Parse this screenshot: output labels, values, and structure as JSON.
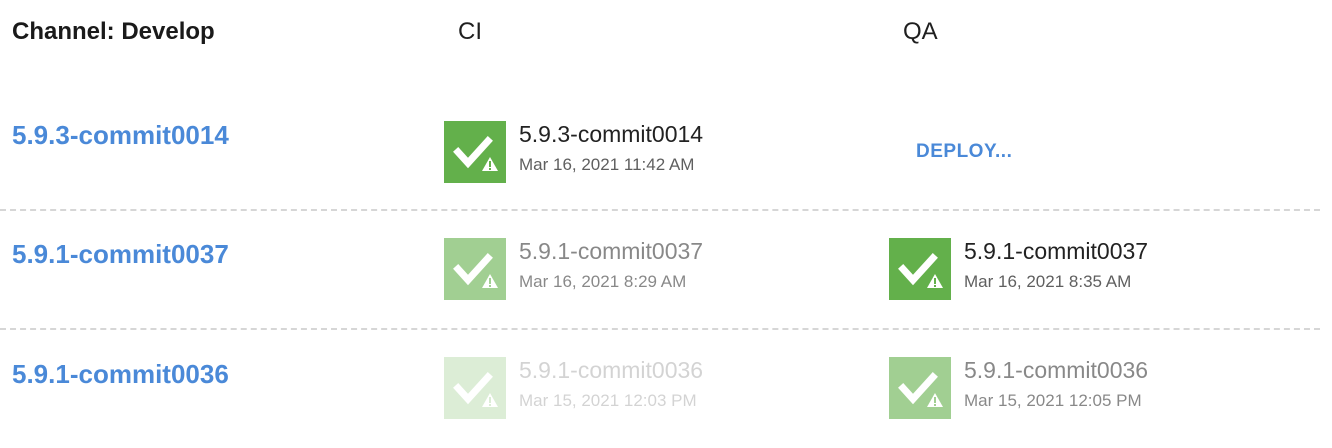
{
  "header": {
    "channel_title": "Channel: Develop",
    "environments": [
      "CI",
      "QA"
    ]
  },
  "colors": {
    "link": "#4a89d8",
    "success_tile": "#63b04b",
    "divider": "#d6d6d6"
  },
  "icons": {
    "status_tile": "success-with-warning-icon"
  },
  "releases": [
    {
      "version": "5.9.3-commit0014",
      "ci": {
        "version": "5.9.3-commit0014",
        "date": "Mar 16, 2021 11:42 AM",
        "status": "success-with-warning"
      },
      "qa": {
        "action_label": "DEPLOY..."
      }
    },
    {
      "version": "5.9.1-commit0037",
      "ci": {
        "version": "5.9.1-commit0037",
        "date": "Mar 16, 2021 8:29 AM",
        "status": "success-with-warning"
      },
      "qa": {
        "version": "5.9.1-commit0037",
        "date": "Mar 16, 2021 8:35 AM",
        "status": "success-with-warning"
      }
    },
    {
      "version": "5.9.1-commit0036",
      "ci": {
        "version": "5.9.1-commit0036",
        "date": "Mar 15, 2021 12:03 PM",
        "status": "success-with-warning"
      },
      "qa": {
        "version": "5.9.1-commit0036",
        "date": "Mar 15, 2021 12:05 PM",
        "status": "success-with-warning"
      }
    }
  ]
}
